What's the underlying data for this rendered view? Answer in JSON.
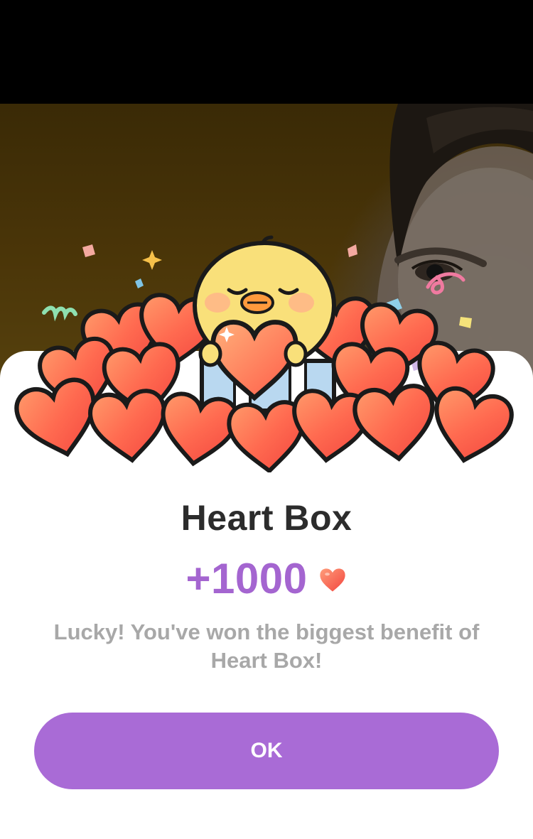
{
  "dialog": {
    "title": "Heart Box",
    "reward_amount": "+1000",
    "reward_icon": "heart-icon",
    "message": "Lucky! You've won the biggest benefit of Heart Box!",
    "ok_label": "OK"
  },
  "colors": {
    "accent": "#a96bd6",
    "reward_text": "#a465d0",
    "title_text": "#2c2c2c",
    "message_text": "#a8a8a8",
    "heart": "#ff5a4a",
    "chick": "#f9e07a"
  }
}
